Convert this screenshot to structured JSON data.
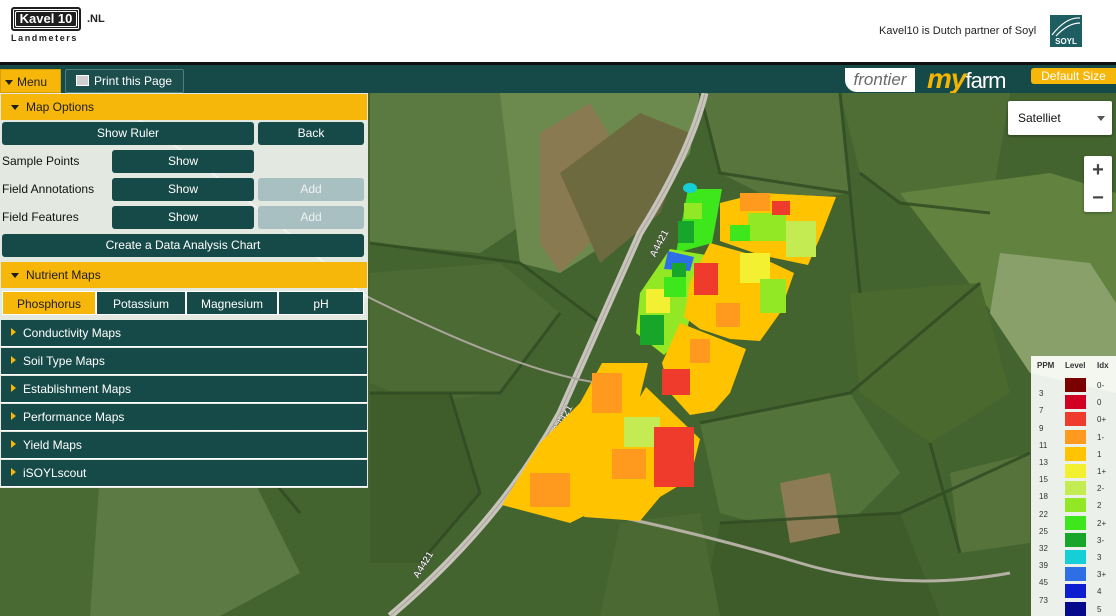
{
  "header": {
    "logo_main": "Kavel 10",
    "logo_suffix": ".NL",
    "logo_sub": "Landmeters",
    "partner_text": "Kavel10 is Dutch partner of Soyl",
    "soyl_logo": "SOYL"
  },
  "topbar": {
    "menu_label": "Menu",
    "print_label": "Print this Page",
    "frontier": "frontier",
    "myfarm_my": "my",
    "myfarm_farm": "farm",
    "default_size": "Default Size"
  },
  "panel": {
    "map_options": "Map Options",
    "show_ruler": "Show Ruler",
    "back": "Back",
    "rows": [
      {
        "label": "Sample Points",
        "show": "Show"
      },
      {
        "label": "Field Annotations",
        "show": "Show",
        "add": "Add"
      },
      {
        "label": "Field Features",
        "show": "Show",
        "add": "Add"
      }
    ],
    "create_chart": "Create a Data Analysis Chart",
    "nutrient_maps": "Nutrient Maps",
    "tabs": [
      "Phosphorus",
      "Potassium",
      "Magnesium",
      "pH"
    ],
    "active_tab": "Phosphorus",
    "sections": [
      "Conductivity Maps",
      "Soil Type Maps",
      "Establishment Maps",
      "Performance Maps",
      "Yield Maps",
      "iSOYLscout"
    ]
  },
  "map": {
    "type_select": "Satelliet",
    "zoom_in": "+",
    "zoom_out": "−",
    "road_label": "A4421"
  },
  "legend": {
    "headers": [
      "PPM",
      "Level",
      "Idx"
    ],
    "rows": [
      {
        "ppm": "",
        "color": "#7b0000",
        "idx": "0-"
      },
      {
        "ppm": "3",
        "color": "#d10022",
        "idx": "0"
      },
      {
        "ppm": "7",
        "color": "#ee3b2c",
        "idx": "0+"
      },
      {
        "ppm": "9",
        "color": "#ff9a1e",
        "idx": "1-"
      },
      {
        "ppm": "11",
        "color": "#ffc300",
        "idx": "1"
      },
      {
        "ppm": "13",
        "color": "#f2f030",
        "idx": "1+"
      },
      {
        "ppm": "15",
        "color": "#c4ec52",
        "idx": "2-"
      },
      {
        "ppm": "18",
        "color": "#93e826",
        "idx": "2"
      },
      {
        "ppm": "22",
        "color": "#3ee61c",
        "idx": "2+"
      },
      {
        "ppm": "25",
        "color": "#17a629",
        "idx": "3-"
      },
      {
        "ppm": "32",
        "color": "#14cfd6",
        "idx": "3"
      },
      {
        "ppm": "39",
        "color": "#2f6fe6",
        "idx": "3+"
      },
      {
        "ppm": "45",
        "color": "#0c1ed0",
        "idx": "4"
      },
      {
        "ppm": "73",
        "color": "#050a8c",
        "idx": "5"
      }
    ]
  }
}
